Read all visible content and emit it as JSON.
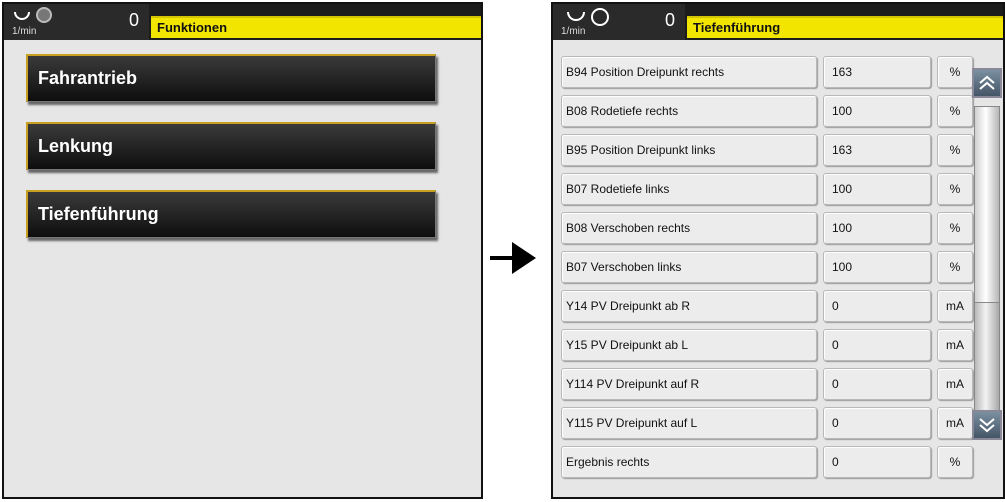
{
  "left_screen": {
    "header": {
      "rpm_unit": "1/min",
      "rpm_value": "0",
      "title": "Funktionen"
    },
    "menu": [
      {
        "label": "Fahrantrieb"
      },
      {
        "label": "Lenkung"
      },
      {
        "label": "Tiefenführung"
      }
    ]
  },
  "right_screen": {
    "header": {
      "rpm_unit": "1/min",
      "rpm_value": "0",
      "title": "Tiefenführung"
    },
    "rows": [
      {
        "name": "B94 Position Dreipunkt rechts",
        "value": "163",
        "unit": "%"
      },
      {
        "name": "B08 Rodetiefe rechts",
        "value": "100",
        "unit": "%"
      },
      {
        "name": "B95 Position Dreipunkt links",
        "value": "163",
        "unit": "%"
      },
      {
        "name": "B07 Rodetiefe links",
        "value": "100",
        "unit": "%"
      },
      {
        "name": "B08 Verschoben rechts",
        "value": "100",
        "unit": "%"
      },
      {
        "name": "B07 Verschoben links",
        "value": "100",
        "unit": "%"
      },
      {
        "name": "Y14 PV Dreipunkt ab R",
        "value": "0",
        "unit": "mA"
      },
      {
        "name": "Y15 PV Dreipunkt ab L",
        "value": "0",
        "unit": "mA"
      },
      {
        "name": "Y114 PV Dreipunkt auf R",
        "value": "0",
        "unit": "mA"
      },
      {
        "name": "Y115 PV Dreipunkt auf L",
        "value": "0",
        "unit": "mA"
      },
      {
        "name": "Ergebnis rechts",
        "value": "0",
        "unit": "%"
      }
    ],
    "scroll_up_icon": "double-chevron-up-icon",
    "scroll_down_icon": "double-chevron-down-icon"
  },
  "arrow_icon": "right-arrow-icon",
  "colors": {
    "title_bar": "#f2e500",
    "header_bg": "#1c1c1c",
    "panel_bg": "#e6e6e6"
  }
}
